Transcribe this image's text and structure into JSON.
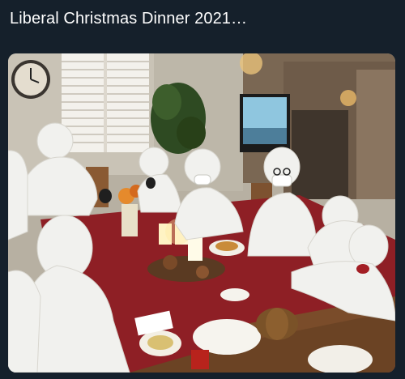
{
  "post": {
    "caption": "Liberal Christmas Dinner 2021…"
  },
  "photo": {
    "subject": "people-in-protective-suits-at-dinner-table"
  },
  "colors": {
    "background": "#15202b",
    "text": "#ffffff",
    "tablecloth": "#8e1f25",
    "suit": "#f1f1ee"
  }
}
